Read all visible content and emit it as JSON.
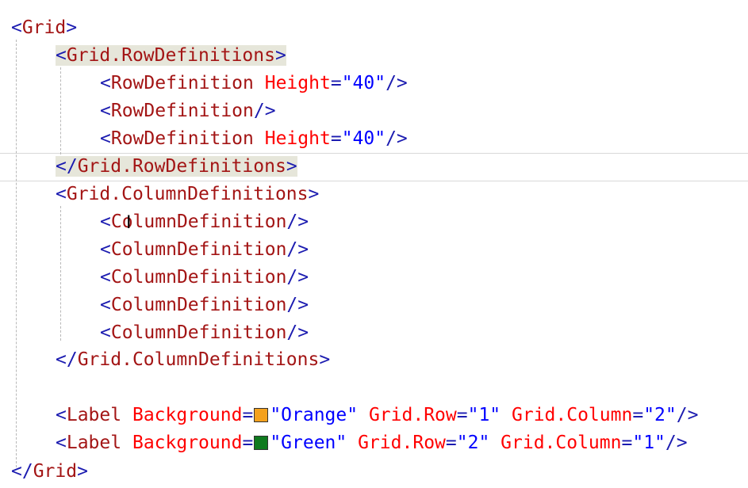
{
  "editor": {
    "lines": [
      {
        "indent": 0,
        "parts": [
          [
            "b",
            "<"
          ],
          [
            "t",
            "Grid"
          ],
          [
            "b",
            ">"
          ]
        ]
      },
      {
        "indent": 1,
        "highlight": true,
        "parts": [
          [
            "b",
            "<"
          ],
          [
            "t",
            "Grid.RowDefinitions"
          ],
          [
            "b",
            ">"
          ]
        ]
      },
      {
        "indent": 2,
        "parts": [
          [
            "b",
            "<"
          ],
          [
            "t",
            "RowDefinition"
          ],
          [
            "s",
            " "
          ],
          [
            "a",
            "Height"
          ],
          [
            "b",
            "="
          ],
          [
            "v",
            "\"40\""
          ],
          [
            "b",
            "/>"
          ]
        ]
      },
      {
        "indent": 2,
        "parts": [
          [
            "b",
            "<"
          ],
          [
            "t",
            "RowDefinition"
          ],
          [
            "b",
            "/>"
          ]
        ]
      },
      {
        "indent": 2,
        "parts": [
          [
            "b",
            "<"
          ],
          [
            "t",
            "RowDefinition"
          ],
          [
            "s",
            " "
          ],
          [
            "a",
            "Height"
          ],
          [
            "b",
            "="
          ],
          [
            "v",
            "\"40\""
          ],
          [
            "b",
            "/>"
          ]
        ]
      },
      {
        "indent": 1,
        "highlight": true,
        "parts": [
          [
            "b",
            "</"
          ],
          [
            "t",
            "Grid.RowDefinitions"
          ],
          [
            "b",
            ">"
          ]
        ]
      },
      {
        "indent": 1,
        "parts": [
          [
            "b",
            "<"
          ],
          [
            "t",
            "Grid.ColumnDefinitions"
          ],
          [
            "b",
            ">"
          ]
        ]
      },
      {
        "indent": 2,
        "parts": [
          [
            "b",
            "<"
          ],
          [
            "t",
            "ColumnDefinition"
          ],
          [
            "b",
            "/>"
          ]
        ]
      },
      {
        "indent": 2,
        "parts": [
          [
            "b",
            "<"
          ],
          [
            "t",
            "ColumnDefinition"
          ],
          [
            "b",
            "/>"
          ]
        ]
      },
      {
        "indent": 2,
        "parts": [
          [
            "b",
            "<"
          ],
          [
            "t",
            "ColumnDefinition"
          ],
          [
            "b",
            "/>"
          ]
        ]
      },
      {
        "indent": 2,
        "parts": [
          [
            "b",
            "<"
          ],
          [
            "t",
            "ColumnDefinition"
          ],
          [
            "b",
            "/>"
          ]
        ]
      },
      {
        "indent": 2,
        "parts": [
          [
            "b",
            "<"
          ],
          [
            "t",
            "ColumnDefinition"
          ],
          [
            "b",
            "/>"
          ]
        ]
      },
      {
        "indent": 1,
        "parts": [
          [
            "b",
            "</"
          ],
          [
            "t",
            "Grid.ColumnDefinitions"
          ],
          [
            "b",
            ">"
          ]
        ]
      },
      {
        "indent": 0,
        "parts": []
      },
      {
        "indent": 1,
        "parts": [
          [
            "b",
            "<"
          ],
          [
            "t",
            "Label"
          ],
          [
            "s",
            " "
          ],
          [
            "a",
            "Background"
          ],
          [
            "b",
            "="
          ],
          [
            "c",
            "#f4a11d"
          ],
          [
            "v",
            "\"Orange\""
          ],
          [
            "s",
            " "
          ],
          [
            "a",
            "Grid.Row"
          ],
          [
            "b",
            "="
          ],
          [
            "v",
            "\"1\""
          ],
          [
            "s",
            " "
          ],
          [
            "a",
            "Grid.Column"
          ],
          [
            "b",
            "="
          ],
          [
            "v",
            "\"2\""
          ],
          [
            "b",
            "/>"
          ]
        ]
      },
      {
        "indent": 1,
        "parts": [
          [
            "b",
            "<"
          ],
          [
            "t",
            "Label"
          ],
          [
            "s",
            " "
          ],
          [
            "a",
            "Background"
          ],
          [
            "b",
            "="
          ],
          [
            "c",
            "#0f7a1e"
          ],
          [
            "v",
            "\"Green\""
          ],
          [
            "s",
            " "
          ],
          [
            "a",
            "Grid.Row"
          ],
          [
            "b",
            "="
          ],
          [
            "v",
            "\"2\""
          ],
          [
            "s",
            " "
          ],
          [
            "a",
            "Grid.Column"
          ],
          [
            "b",
            "="
          ],
          [
            "v",
            "\"1\""
          ],
          [
            "b",
            "/>"
          ]
        ]
      },
      {
        "indent": 0,
        "parts": [
          [
            "b",
            "</"
          ],
          [
            "t",
            "Grid"
          ],
          [
            "b",
            ">"
          ]
        ]
      }
    ]
  },
  "colors": {
    "bracket": "#1b1bb0",
    "element": "#a31515",
    "attribute": "#ff0000",
    "value": "#0000ff",
    "tag_highlight": "#e6e6da"
  }
}
